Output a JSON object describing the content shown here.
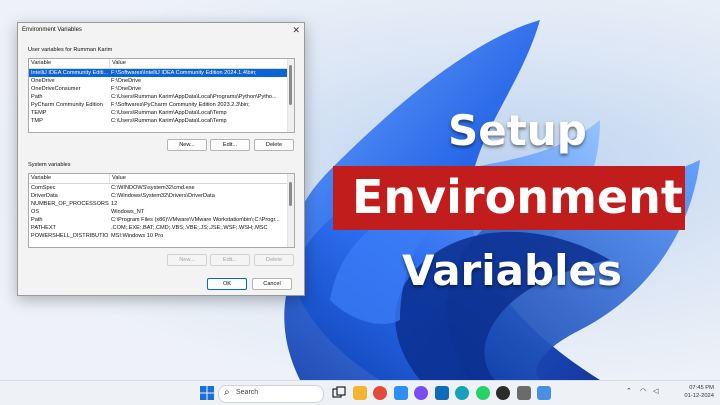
{
  "dialog": {
    "title": "Environment Variables",
    "close_glyph": "✕",
    "user_section_label": "User variables for Rumman Karim",
    "system_section_label": "System variables",
    "col_variable": "Variable",
    "col_value": "Value",
    "user_vars": [
      {
        "name": "IntelliJ IDEA Community Editi...",
        "value": "F:\\Softwares\\IntelliJ IDEA Community Edition 2024.1.4\\bin;",
        "selected": true
      },
      {
        "name": "OneDrive",
        "value": "F:\\OneDrive"
      },
      {
        "name": "OneDriveConsumer",
        "value": "F:\\OneDrive"
      },
      {
        "name": "Path",
        "value": "C:\\Users\\Rumman Karim\\AppData\\Local\\Programs\\Python\\Pytho..."
      },
      {
        "name": "PyCharm Community Edition",
        "value": "F:\\Softwares\\PyCharm Community Edition 2023.2.3\\bin;"
      },
      {
        "name": "TEMP",
        "value": "C:\\Users\\Rumman Karim\\AppData\\Local\\Temp"
      },
      {
        "name": "TMP",
        "value": "C:\\Users\\Rumman Karim\\AppData\\Local\\Temp"
      }
    ],
    "system_vars": [
      {
        "name": "ComSpec",
        "value": "C:\\WINDOWS\\system32\\cmd.exe"
      },
      {
        "name": "DriverData",
        "value": "C:\\Windows\\System32\\Drivers\\DriverData"
      },
      {
        "name": "NUMBER_OF_PROCESSORS",
        "value": "12"
      },
      {
        "name": "OS",
        "value": "Windows_NT"
      },
      {
        "name": "Path",
        "value": "C:\\Program Files (x86)\\VMware\\VMware Workstation\\bin\\;C:\\Progr..."
      },
      {
        "name": "PATHEXT",
        "value": ".COM;.EXE;.BAT;.CMD;.VBS;.VBE;.JS;.JSE;.WSF;.WSH;.MSC"
      },
      {
        "name": "POWERSHELL_DISTRIBUTIO...",
        "value": "MSI:Windows 10 Pro"
      }
    ],
    "buttons": {
      "new": "New...",
      "edit": "Edit...",
      "delete": "Delete",
      "ok": "OK",
      "cancel": "Cancel"
    }
  },
  "overlay": {
    "line1": "Setup",
    "line2": "Environment",
    "line3": "Variables",
    "banner_color": "#c11d1d"
  },
  "taskbar": {
    "search_placeholder": "Search",
    "time": "07:45 PM",
    "date": "01-12-2024",
    "apps": [
      {
        "icon": "start-icon",
        "color": "#1a6fd8"
      },
      {
        "icon": "task-view-icon",
        "color": "#222222"
      },
      {
        "icon": "file-explorer-icon",
        "color": "#f2b632"
      },
      {
        "icon": "chrome-icon",
        "color": "#e24b3b"
      },
      {
        "icon": "photos-icon",
        "color": "#2f8ef2"
      },
      {
        "icon": "messenger-icon",
        "color": "#7a4df2"
      },
      {
        "icon": "outlook-icon",
        "color": "#0f6cbd"
      },
      {
        "icon": "edge-icon",
        "color": "#16a2b8"
      },
      {
        "icon": "whatsapp-icon",
        "color": "#25d366"
      },
      {
        "icon": "obs-icon",
        "color": "#2b2b2b"
      },
      {
        "icon": "settings-icon",
        "color": "#6b6b6b"
      },
      {
        "icon": "app-icon",
        "color": "#4a90e2"
      }
    ],
    "tray": [
      "chevron-up-icon",
      "wifi-icon",
      "volume-icon"
    ]
  }
}
